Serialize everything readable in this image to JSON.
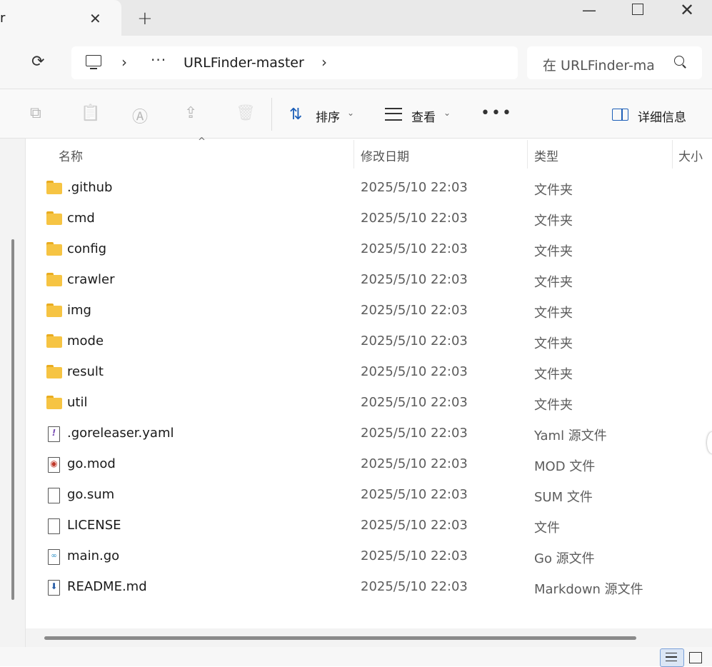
{
  "tab": {
    "title_fragment": "r",
    "close_glyph": "✕",
    "new_tab_glyph": "+"
  },
  "window": {
    "minimize_glyph": "—",
    "close_glyph": "✕"
  },
  "nav": {
    "refresh_glyph": "⟳",
    "breadcrumb": {
      "chevron": "›",
      "more": "···",
      "folder": "URLFinder-master"
    },
    "search_placeholder": "在 URLFinder-master 中搜索"
  },
  "toolbar": {
    "copy_glyph": "⧉",
    "paste_glyph": "📋",
    "rename_glyph": "Ⓐ",
    "share_glyph": "⇪",
    "delete_glyph": "🗑",
    "sort_glyph": "⇅",
    "sort_label": "排序",
    "view_label": "查看",
    "dropdown_glyph": "⌄",
    "more_glyph": "•••",
    "details_label": "详细信息"
  },
  "columns": {
    "name": "名称",
    "date": "修改日期",
    "type": "类型",
    "size": "大小",
    "sort_caret": "^"
  },
  "files": [
    {
      "name": ".github",
      "date": "2025/5/10 22:03",
      "type": "文件夹",
      "icon": "folder-icon"
    },
    {
      "name": "cmd",
      "date": "2025/5/10 22:03",
      "type": "文件夹",
      "icon": "folder-icon"
    },
    {
      "name": "config",
      "date": "2025/5/10 22:03",
      "type": "文件夹",
      "icon": "folder-icon"
    },
    {
      "name": "crawler",
      "date": "2025/5/10 22:03",
      "type": "文件夹",
      "icon": "folder-icon"
    },
    {
      "name": "img",
      "date": "2025/5/10 22:03",
      "type": "文件夹",
      "icon": "folder-icon"
    },
    {
      "name": "mode",
      "date": "2025/5/10 22:03",
      "type": "文件夹",
      "icon": "folder-icon"
    },
    {
      "name": "result",
      "date": "2025/5/10 22:03",
      "type": "文件夹",
      "icon": "folder-icon"
    },
    {
      "name": "util",
      "date": "2025/5/10 22:03",
      "type": "文件夹",
      "icon": "folder-icon"
    },
    {
      "name": ".goreleaser.yaml",
      "date": "2025/5/10 22:03",
      "type": "Yaml 源文件",
      "icon": "yaml-file-icon",
      "glyph": "!"
    },
    {
      "name": "go.mod",
      "date": "2025/5/10 22:03",
      "type": "MOD 文件",
      "icon": "media-file-icon",
      "glyph": "◉"
    },
    {
      "name": "go.sum",
      "date": "2025/5/10 22:03",
      "type": "SUM 文件",
      "icon": "file-icon",
      "glyph": ""
    },
    {
      "name": "LICENSE",
      "date": "2025/5/10 22:03",
      "type": "文件",
      "icon": "file-icon",
      "glyph": ""
    },
    {
      "name": "main.go",
      "date": "2025/5/10 22:03",
      "type": "Go 源文件",
      "icon": "go-file-icon",
      "glyph": "∞"
    },
    {
      "name": "README.md",
      "date": "2025/5/10 22:03",
      "type": "Markdown 源文件",
      "icon": "markdown-file-icon",
      "glyph": "⬇"
    }
  ],
  "colors": {
    "folder": "#f6c443",
    "accent": "#1d5fb8"
  }
}
